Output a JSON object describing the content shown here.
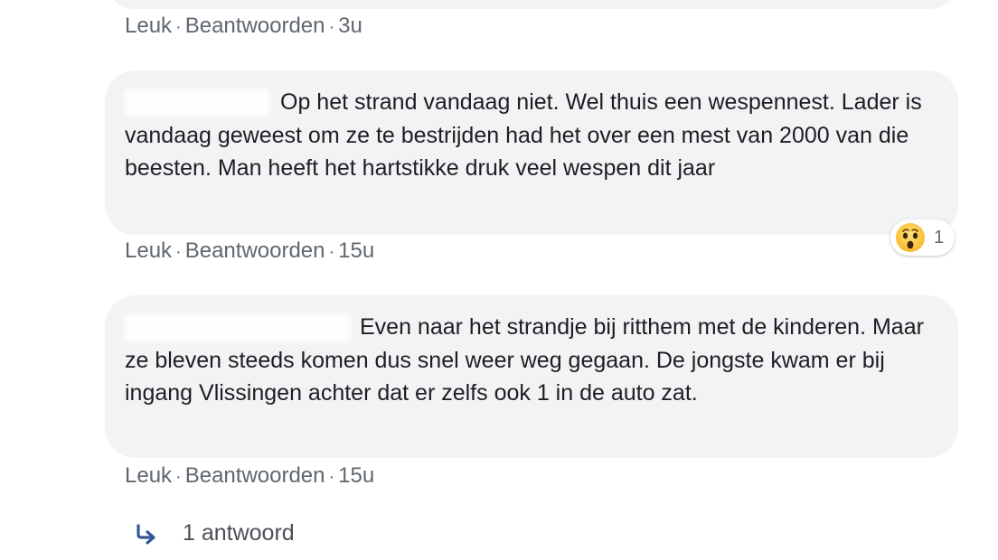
{
  "comment_0": {
    "actions": {
      "like": "Leuk",
      "reply": "Beantwoorden",
      "time": "3u"
    }
  },
  "comment_1": {
    "text": "Op het strand vandaag niet. Wel thuis een wespennest. Lader is vandaag geweest om ze te bestrijden had het over een mest van 2000 van die beesten. Man heeft het hartstikke druk veel wespen dit jaar",
    "reaction": {
      "icon": "wow-emoji-icon",
      "count": "1"
    },
    "actions": {
      "like": "Leuk",
      "reply": "Beantwoorden",
      "time": "15u"
    }
  },
  "comment_2": {
    "text": "Even naar het strandje bij ritthem met de kinderen. Maar ze bleven steeds komen dus snel weer weg gegaan. De jongste kwam er bij ingang Vlissingen achter dat er zelfs ook 1 in de auto zat.",
    "actions": {
      "like": "Leuk",
      "reply": "Beantwoorden",
      "time": "15u"
    },
    "replies": {
      "icon": "reply-arrow-icon",
      "label": "1 antwoord"
    }
  },
  "separator": "·",
  "colors": {
    "bubble": "#f2f3f5",
    "meta_text": "#606770",
    "reply_arrow": "#365899"
  }
}
